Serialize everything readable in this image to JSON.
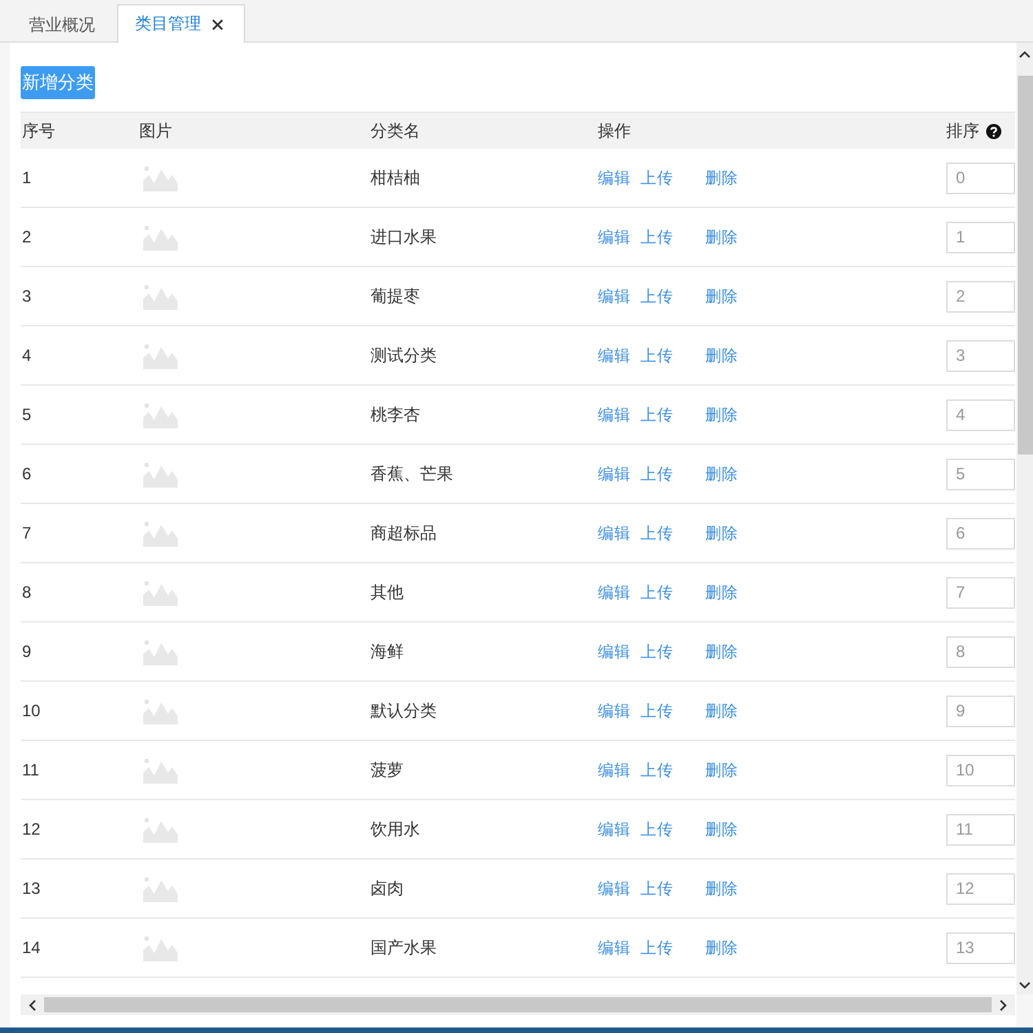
{
  "tabs": [
    {
      "label": "营业概况",
      "selected": false,
      "closable": false
    },
    {
      "label": "类目管理",
      "selected": true,
      "closable": true
    }
  ],
  "add_button": "新增分类",
  "table": {
    "columns": [
      {
        "label": "序号",
        "help": false
      },
      {
        "label": "图片",
        "help": false
      },
      {
        "label": "分类名",
        "help": false
      },
      {
        "label": "操作",
        "help": false
      },
      {
        "label": "排序",
        "help": true
      }
    ],
    "rows": [
      {
        "no": "1",
        "name": "柑桔柚",
        "actions": [
          "编辑",
          "上传",
          "删除"
        ],
        "sort": "0"
      },
      {
        "no": "2",
        "name": "进口水果",
        "actions": [
          "编辑",
          "上传",
          "删除"
        ],
        "sort": "1"
      },
      {
        "no": "3",
        "name": "葡提枣",
        "actions": [
          "编辑",
          "上传",
          "删除"
        ],
        "sort": "2"
      },
      {
        "no": "4",
        "name": "测试分类",
        "actions": [
          "编辑",
          "上传",
          "删除"
        ],
        "sort": "3"
      },
      {
        "no": "5",
        "name": "桃李杏",
        "actions": [
          "编辑",
          "上传",
          "删除"
        ],
        "sort": "4"
      },
      {
        "no": "6",
        "name": "香蕉、芒果",
        "actions": [
          "编辑",
          "上传",
          "删除"
        ],
        "sort": "5"
      },
      {
        "no": "7",
        "name": "商超标品",
        "actions": [
          "编辑",
          "上传",
          "删除"
        ],
        "sort": "6"
      },
      {
        "no": "8",
        "name": "其他",
        "actions": [
          "编辑",
          "上传",
          "删除"
        ],
        "sort": "7"
      },
      {
        "no": "9",
        "name": "海鲜",
        "actions": [
          "编辑",
          "上传",
          "删除"
        ],
        "sort": "8"
      },
      {
        "no": "10",
        "name": "默认分类",
        "actions": [
          "编辑",
          "上传",
          "删除"
        ],
        "sort": "9"
      },
      {
        "no": "11",
        "name": "菠萝",
        "actions": [
          "编辑",
          "上传",
          "删除"
        ],
        "sort": "10"
      },
      {
        "no": "12",
        "name": "饮用水",
        "actions": [
          "编辑",
          "上传",
          "删除"
        ],
        "sort": "11"
      },
      {
        "no": "13",
        "name": "卤肉",
        "actions": [
          "编辑",
          "上传",
          "删除"
        ],
        "sort": "12"
      },
      {
        "no": "14",
        "name": "国产水果",
        "actions": [
          "编辑",
          "上传",
          "删除"
        ],
        "sort": "13"
      }
    ]
  }
}
